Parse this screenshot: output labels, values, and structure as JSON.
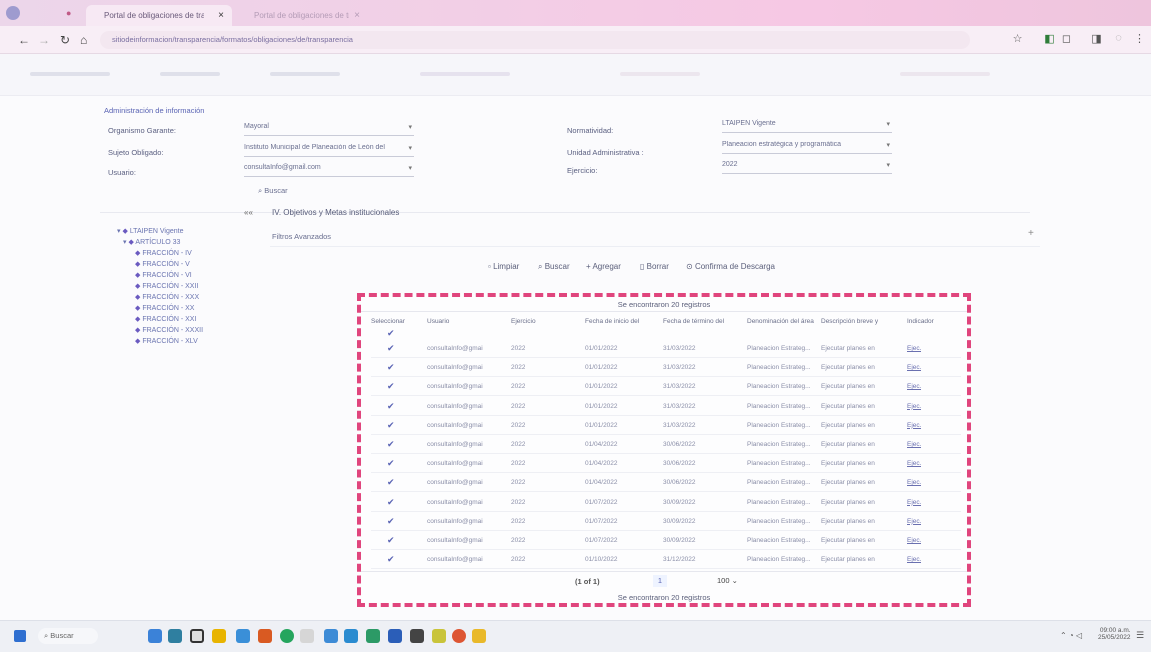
{
  "browser": {
    "tabs": [
      {
        "title": "Portal de obligaciones de transparencia",
        "close": "×",
        "active": true
      },
      {
        "title": "Portal de obligaciones de transparencia",
        "close": "×",
        "active": false
      }
    ],
    "url": "sitiodeinformacion/transparencia/formatos/obligaciones/de/transparencia"
  },
  "form": {
    "section_title": "Administración de información",
    "fields": {
      "sujeto_cargo_label": "Organismo Garante:",
      "sujeto_cargo_value": "Mayoral",
      "sujeto_obligado_label": "Sujeto Obligado:",
      "sujeto_obligado_value": "Instituto Municipal de Planeación de León del",
      "usuario_label": "Usuario:",
      "usuario_value": "consultaInfo@gmail.com",
      "normatividad_label": "Normatividad:",
      "normatividad_value": "LTAIPEN Vigente",
      "unidad_label": "Unidad Administrativa :",
      "unidad_value": "Planeacion estratégica y programática",
      "ejercicio_label": "Ejercicio:",
      "ejercicio_value": "2022"
    },
    "buscar_label": "Buscar"
  },
  "breadcrumb": {
    "collapse": "««",
    "text": "IV. Objetivos y Metas institucionales"
  },
  "filters": {
    "label": "Filtros Avanzados",
    "plus": "+"
  },
  "tree": {
    "root": "LTAIPEN Vigente",
    "article": "ARTÍCULO 33",
    "items": [
      "FRACCIÓN - IV",
      "FRACCIÓN - V",
      "FRACCIÓN - VI",
      "FRACCIÓN - XXII",
      "FRACCIÓN - XXX",
      "FRACCIÓN - XX",
      "FRACCIÓN - XXI",
      "FRACCIÓN - XXXII",
      "FRACCIÓN - XLV"
    ]
  },
  "toolbar": {
    "limpiar": "Limpiar",
    "buscar": "Buscar",
    "agregar": "Agregar",
    "borrar": "Borrar",
    "descarga": "Confirma de Descarga"
  },
  "table": {
    "caption_top": "Se encontraron 20 registros",
    "caption_bottom": "Se encontraron 20 registros",
    "headers": [
      "Seleccionar",
      "Usuario",
      "Ejercicio",
      "Fecha de inicio del",
      "Fecha de término del",
      "Denominación del área",
      "Descripción breve y",
      "Indicador"
    ],
    "rows": [
      {
        "usuario": "consultaInfo@gmai",
        "ejercicio": "2022",
        "inicio": "01/01/2022",
        "termino": "31/03/2022",
        "area": "Planeacion Estrateg...",
        "desc": "Ejecutar planes en",
        "ind": "Ejec."
      },
      {
        "usuario": "consultaInfo@gmai",
        "ejercicio": "2022",
        "inicio": "01/01/2022",
        "termino": "31/03/2022",
        "area": "Planeacion Estrateg...",
        "desc": "Ejecutar planes en",
        "ind": "Ejec."
      },
      {
        "usuario": "consultaInfo@gmai",
        "ejercicio": "2022",
        "inicio": "01/01/2022",
        "termino": "31/03/2022",
        "area": "Planeacion Estrateg...",
        "desc": "Ejecutar planes en",
        "ind": "Ejec."
      },
      {
        "usuario": "consultaInfo@gmai",
        "ejercicio": "2022",
        "inicio": "01/01/2022",
        "termino": "31/03/2022",
        "area": "Planeacion Estrateg...",
        "desc": "Ejecutar planes en",
        "ind": "Ejec."
      },
      {
        "usuario": "consultaInfo@gmai",
        "ejercicio": "2022",
        "inicio": "01/01/2022",
        "termino": "31/03/2022",
        "area": "Planeacion Estrateg...",
        "desc": "Ejecutar planes en",
        "ind": "Ejec."
      },
      {
        "usuario": "consultaInfo@gmai",
        "ejercicio": "2022",
        "inicio": "01/04/2022",
        "termino": "30/06/2022",
        "area": "Planeacion Estrateg...",
        "desc": "Ejecutar planes en",
        "ind": "Ejec."
      },
      {
        "usuario": "consultaInfo@gmai",
        "ejercicio": "2022",
        "inicio": "01/04/2022",
        "termino": "30/06/2022",
        "area": "Planeacion Estrateg...",
        "desc": "Ejecutar planes en",
        "ind": "Ejec."
      },
      {
        "usuario": "consultaInfo@gmai",
        "ejercicio": "2022",
        "inicio": "01/04/2022",
        "termino": "30/06/2022",
        "area": "Planeacion Estrateg...",
        "desc": "Ejecutar planes en",
        "ind": "Ejec."
      },
      {
        "usuario": "consultaInfo@gmai",
        "ejercicio": "2022",
        "inicio": "01/07/2022",
        "termino": "30/09/2022",
        "area": "Planeacion Estrateg...",
        "desc": "Ejecutar planes en",
        "ind": "Ejec."
      },
      {
        "usuario": "consultaInfo@gmai",
        "ejercicio": "2022",
        "inicio": "01/07/2022",
        "termino": "30/09/2022",
        "area": "Planeacion Estrateg...",
        "desc": "Ejecutar planes en",
        "ind": "Ejec."
      },
      {
        "usuario": "consultaInfo@gmai",
        "ejercicio": "2022",
        "inicio": "01/07/2022",
        "termino": "30/09/2022",
        "area": "Planeacion Estrateg...",
        "desc": "Ejecutar planes en",
        "ind": "Ejec."
      },
      {
        "usuario": "consultaInfo@gmai",
        "ejercicio": "2022",
        "inicio": "01/10/2022",
        "termino": "31/12/2022",
        "area": "Planeacion Estrateg...",
        "desc": "Ejecutar planes en",
        "ind": "Ejec."
      }
    ],
    "pager": "(1 of 1)",
    "page": "1",
    "per_page": "100"
  },
  "taskbar": {
    "search": "Buscar",
    "time": "09:00 a.m.",
    "date": "25/05/2022"
  },
  "colors": {
    "highlight": "#e0457d",
    "tab_gradient": "#f6c8e4"
  }
}
